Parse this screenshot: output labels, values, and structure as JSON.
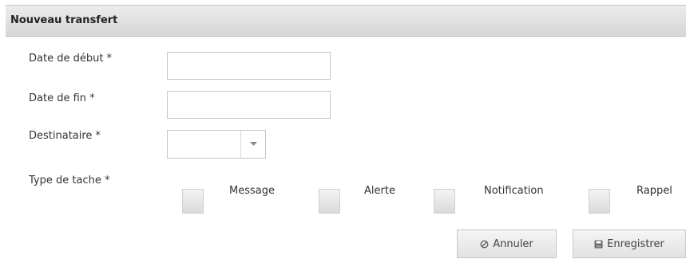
{
  "panel": {
    "title": "Nouveau transfert"
  },
  "form": {
    "start_date": {
      "label": "Date de début *",
      "value": ""
    },
    "end_date": {
      "label": "Date de fin *",
      "value": ""
    },
    "recipient": {
      "label": "Destinataire *",
      "selected": ""
    },
    "task_type": {
      "label": "Type de tache *",
      "options": [
        {
          "label": "Message",
          "checked": false
        },
        {
          "label": "Alerte",
          "checked": false
        },
        {
          "label": "Notification",
          "checked": false
        },
        {
          "label": "Rappel",
          "checked": false
        }
      ]
    }
  },
  "actions": {
    "cancel_label": "Annuler",
    "cancel_icon": "cancel-circle-icon",
    "save_label": "Enregistrer",
    "save_icon": "save-icon"
  },
  "colors": {
    "header_bg": "#dcdcdc",
    "border": "#c6c6c6",
    "text": "#333333"
  }
}
